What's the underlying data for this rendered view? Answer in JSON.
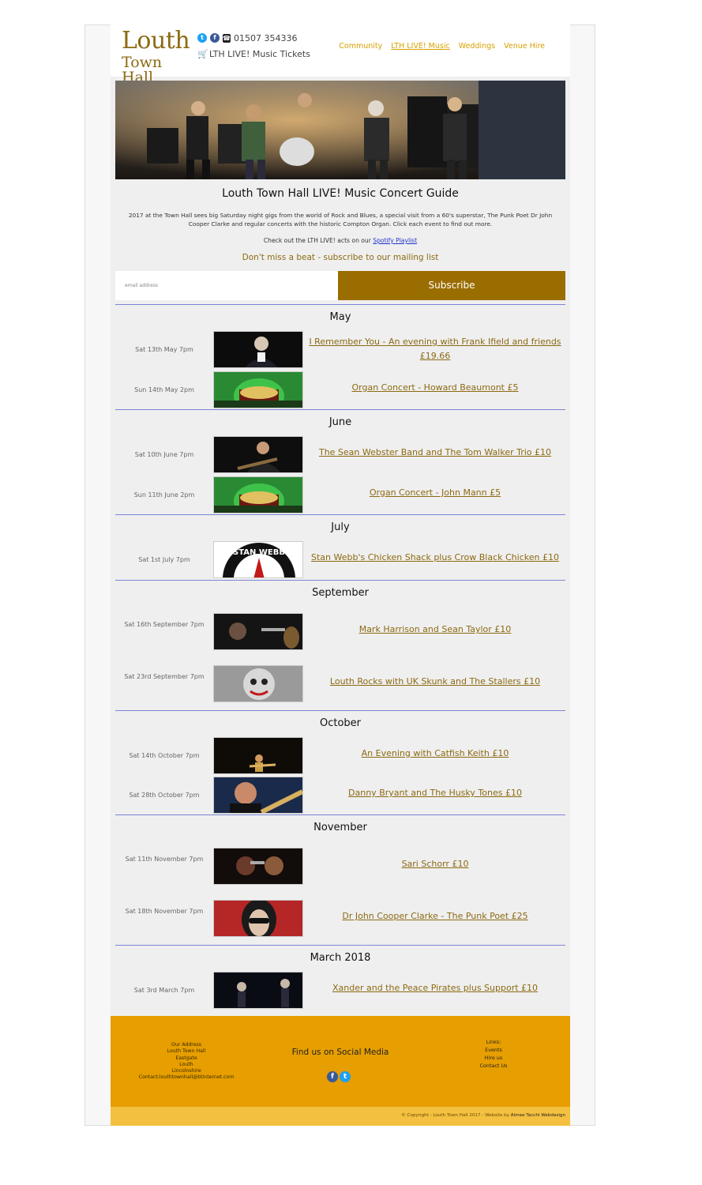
{
  "header": {
    "logo_line1": "Louth",
    "logo_line2": "Town Hall",
    "phone": "01507 354336",
    "tickets": "LTH LIVE! Music Tickets",
    "nav": [
      "Community",
      "LTH LIVE! Music",
      "Weddings",
      "Venue Hire"
    ]
  },
  "main": {
    "title": "Louth Town Hall LIVE! Music Concert Guide",
    "intro": "2017 at the Town Hall sees big Saturday night gigs from the world of Rock and Blues, a special visit from a 60's superstar, The Punk Poet Dr John Cooper Clarke and regular concerts with the historic Compton Organ. Click each event to find out more.",
    "spotify_text": "Check out the LTH LIVE! acts on our ",
    "spotify_link": "Spotify Playlist",
    "mailing": "Don't miss a beat - subscribe to our mailing list",
    "email_placeholder": "email address",
    "subscribe": "Subscribe"
  },
  "months": [
    {
      "name": "May",
      "events": [
        {
          "date": "Sat 13th May 7pm",
          "title": "I Remember You - An evening with Frank Ifield and friends £19.66"
        },
        {
          "date": "Sun 14th May 2pm",
          "title": "Organ Concert - Howard Beaumont £5"
        }
      ]
    },
    {
      "name": "June",
      "events": [
        {
          "date": "Sat 10th June 7pm",
          "title": "The Sean Webster Band and The Tom Walker Trio £10"
        },
        {
          "date": "Sun 11th June 2pm",
          "title": "Organ Concert - John Mann £5"
        }
      ]
    },
    {
      "name": "July",
      "events": [
        {
          "date": "Sat 1st July 7pm",
          "title": "Stan Webb's Chicken Shack plus Crow Black Chicken £10"
        }
      ]
    },
    {
      "name": "September",
      "events": [
        {
          "date": "Sat 16th September 7pm",
          "title": "Mark Harrison and Sean Taylor £10"
        },
        {
          "date": "Sat 23rd September 7pm",
          "title": "Louth Rocks with UK Skunk and The Stallers £10"
        }
      ]
    },
    {
      "name": "October",
      "events": [
        {
          "date": "Sat 14th October 7pm",
          "title": "An Evening with Catfish Keith £10"
        },
        {
          "date": "Sat 28th October 7pm",
          "title": "Danny Bryant and The Husky Tones £10"
        }
      ]
    },
    {
      "name": "November",
      "events": [
        {
          "date": "Sat 11th November 7pm",
          "title": "Sari Schorr £10"
        },
        {
          "date": "Sat 18th November 7pm",
          "title": "Dr John Cooper Clarke - The Punk Poet £25"
        }
      ]
    },
    {
      "name": "March 2018",
      "events": [
        {
          "date": "Sat 3rd March 7pm",
          "title": "Xander and the Peace Pirates plus Support £10"
        }
      ]
    }
  ],
  "footer": {
    "address": [
      "Our Address",
      "Louth Town Hall",
      "Eastgate",
      "Louth",
      "Lincolnshire",
      "Contact:louthtownhall@btinternet.com"
    ],
    "social_title": "Find us on Social Media",
    "links": [
      "Links:",
      "Events",
      "Hire us",
      "Contact Us"
    ],
    "copyright": "© Copyright - Louth Town Hall 2017 - Website by ",
    "credit": "Aimee Tacchi Webdesign"
  },
  "colors": {
    "gold": "#8c6a12",
    "nav": "#d8a000",
    "subscribe": "#9a6d00",
    "footer": "#e69e00",
    "divider": "#7b86d4"
  }
}
